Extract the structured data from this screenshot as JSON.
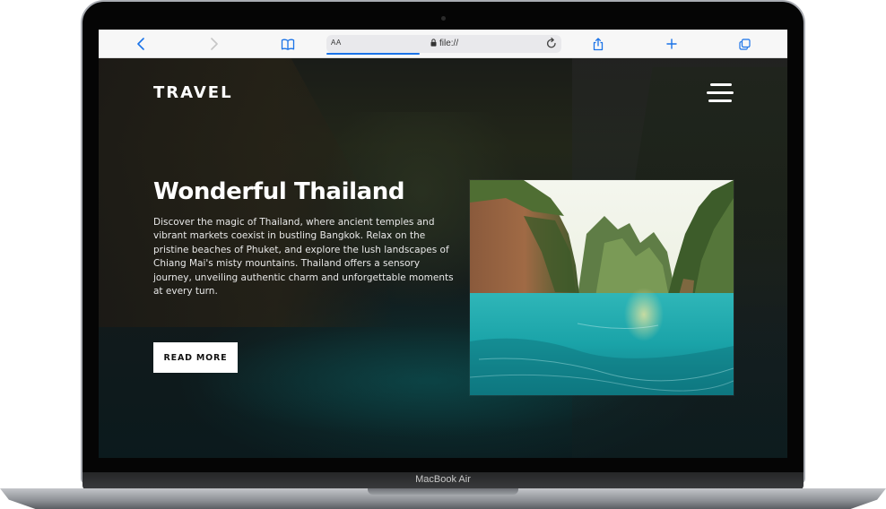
{
  "device": {
    "model_label": "MacBook Air"
  },
  "browser": {
    "text_size_label": "AA",
    "url": "file://",
    "accent_color": "#1a73e8",
    "icons": [
      "back-icon",
      "forward-icon",
      "bookmarks-icon",
      "lock-icon",
      "reload-icon",
      "share-icon",
      "new-tab-icon",
      "tabs-icon"
    ]
  },
  "site": {
    "brand": "TRAVEL",
    "headline": "Wonderful Thailand",
    "description": "Discover the magic of Thailand, where ancient temples and vibrant markets coexist in bustling Bangkok. Relax on the pristine beaches of Phuket, and explore the lush landscapes of Chiang Mai's misty mountains. Thailand offers a sensory journey, unveiling authentic charm and unforgettable moments at every turn.",
    "cta_label": "READ MORE",
    "social_icons": [
      "facebook-icon",
      "instagram-icon",
      "x-icon"
    ]
  }
}
